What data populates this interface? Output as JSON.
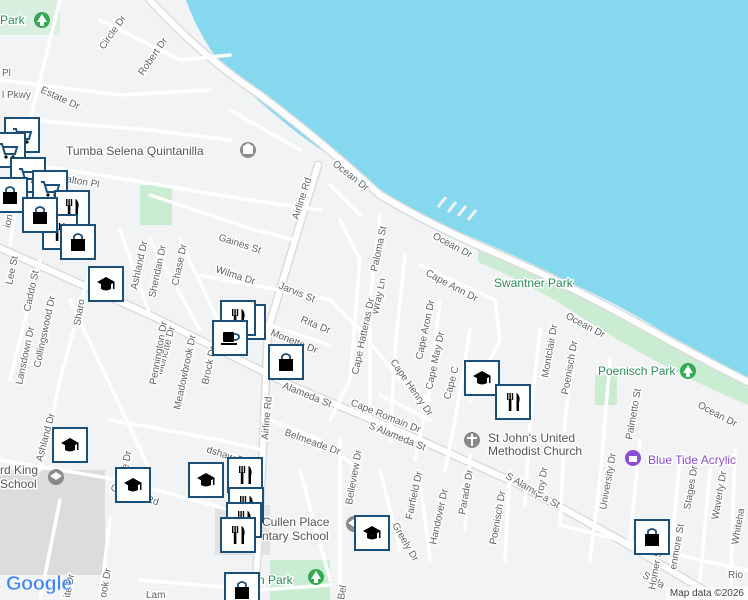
{
  "map": {
    "colors": {
      "water": "#86d8ee",
      "land": "#f1f3f4",
      "park": "#c9ecd2",
      "school_grounds": "#dcdcdc",
      "road": "#ffffff",
      "road_outline": "#dadce0",
      "label": "#5f6368",
      "park_label": "#2e8b57",
      "church_label": "#555555",
      "marker": "#1a4f7a",
      "purple": "#8d4fd1"
    },
    "streets": {
      "circle_dr": "Circle Dr",
      "robert_dr": "Robert Dr",
      "estate_dr": "Estate Dr",
      "pkwy": "l Pkwy",
      "pl": "Pl",
      "ocean_dr_1": "Ocean Dr",
      "ocean_dr_2": "Ocean Dr",
      "ocean_dr_3": "Ocean Dr",
      "ocean_dr_4": "Ocean Dr",
      "airline_rd_1": "Airline Rd",
      "airline_rd_2": "Airline Rd",
      "walton_pl": "alton Pl",
      "gaines_st": "Gaines St",
      "wilma_dr": "Wilma Dr",
      "jarvis_st": "Jarvis St",
      "rita_dr": "Rita Dr",
      "monette_dr_1": "Monette Dr",
      "monette_dr_2": "Monette Dr",
      "paloma_st": "Paloma St",
      "wray_ln": "Wray Ln",
      "cape_hatteras_dr": "Cape Hatteras Dr",
      "cape_ann_dr": "Cape Ann Dr",
      "cape_aron_dr": "Cape Aron Dr",
      "cape_may_dr": "Cape May Dr",
      "cape_henry_dr": "Cape Henry Dr",
      "cape_c_dr": "Cape C",
      "cape_romain_dr": "Cape Romain Dr",
      "alameda_st": "Alameda St",
      "s_alameda_st_1": "S Alameda St",
      "s_alameda_st_2": "S Alameda St",
      "s_alameda_st_3": "S Ala",
      "belmeade_dr": "Belmeade Dr",
      "bradshaw_dr": "dshaw Dr",
      "belleview_dr": "Belleview Dr",
      "fairfield_dr": "Fairfield Dr",
      "greely_dr": "Greely Dr",
      "handover_dr": "Handover Dr",
      "parade_dr": "Parade Dr",
      "poenisch_dr_1": "Poenisch Dr",
      "poenisch_dr_2": "Poenisch Dr",
      "troy_dr": "Troy Dr",
      "university_dr": "University Dr",
      "montclair_dr": "Montclair Dr",
      "palmetto_st": "Palmetto St",
      "stages_dr": "Stages Dr",
      "waverly_dr": "Waverly Dr",
      "whitehall": "Whiteha",
      "homer_st": "Homer St",
      "fenmore_st": "enmore St",
      "rio": "Rio",
      "ashland_dr_1": "Ashland Dr",
      "ashland_dr_2": "Ashland Dr",
      "sheridan_dr": "Sheridan Dr",
      "chase_dr": "Chase Dr",
      "lee_st": "Lee St",
      "caddo_st": "Caddo St",
      "collingswood_dr": "Collingswood Dr",
      "lansdown_dr": "Lansdown Dr",
      "sharon": "Sharo",
      "pennington_dr": "Pennington Dr",
      "meadowbrook_dr": "Meadowbrook Dr",
      "brock_dr": "Brock Dr",
      "gollihar_rd": "Gollihar Rd",
      "e_dr": "e Dr",
      "ite_dr": "ite Dr",
      "ook_dr": "ook Dr",
      "lam": "Lam",
      "ton_dr": "ion Dr",
      "bel": "Bel"
    },
    "places": {
      "park_top": "Park",
      "tumba": "Tumba Selena Quintanilla",
      "swantner_park": "Swantner Park",
      "poenisch_park": "Poenisch Park",
      "st_johns_1": "St John's United",
      "st_johns_2": "Methodist Church",
      "blue_tide": "Blue Tide Acrylic",
      "king_school_1": "rd King",
      "king_school_2": "School",
      "cullen_1": "Cullen Place",
      "cullen_2": "ntary School",
      "bottom_park": "n Park"
    },
    "icons": {
      "park": "tree-icon",
      "monument": "monument-icon",
      "school": "graduation-cap-icon",
      "restaurant": "fork-knife-icon",
      "shopping": "shopping-bag-icon",
      "cafe": "coffee-cup-icon",
      "cart": "shopping-cart-icon",
      "church": "cross-icon"
    }
  },
  "footer": {
    "logo": "Google",
    "attribution": "Map data ©2026"
  }
}
